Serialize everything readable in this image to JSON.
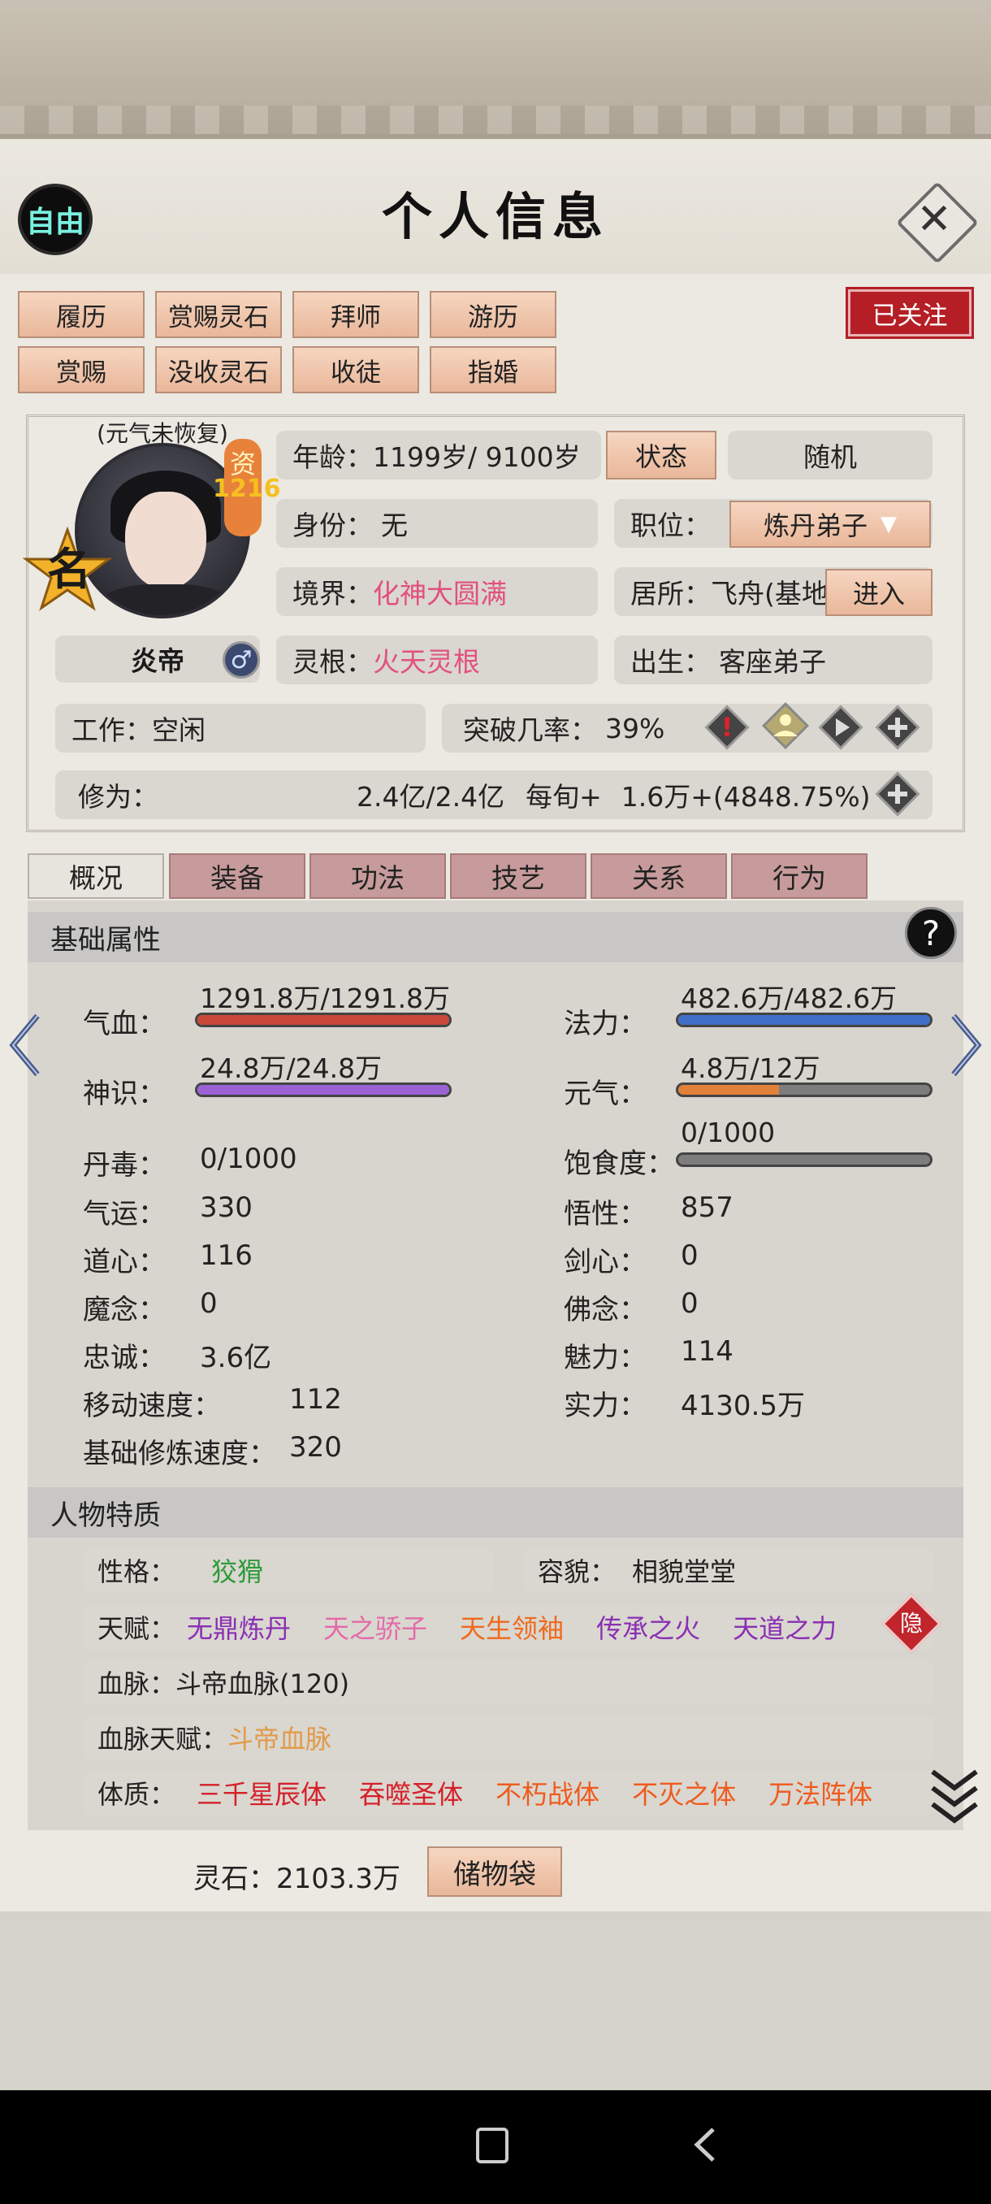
{
  "header": {
    "free_label": "自由",
    "title": "个人信息",
    "follow_label": "已关注"
  },
  "action_buttons": [
    "履历",
    "赏赐灵石",
    "拜师",
    "游历",
    "赏赐",
    "没收灵石",
    "收徒",
    "指婚"
  ],
  "profile": {
    "status_note": "(元气未恢复)",
    "zi_label": "资",
    "zi_value": "1216",
    "ming_label": "名",
    "name": "炎帝",
    "age_label": "年龄：",
    "age_value": "1199岁/ 9100岁",
    "status_btn": "状态",
    "random_btn": "随机",
    "identity_label": "身份：",
    "identity_value": "无",
    "position_label": "职位：",
    "position_value": "炼丹弟子",
    "realm_label": "境界：",
    "realm_value": "化神大圆满",
    "residence_label": "居所：",
    "residence_value": "飞舟(基地",
    "enter_btn": "进入",
    "root_label": "灵根：",
    "root_value": "火天灵根",
    "birth_label": "出生：",
    "birth_value": "客座弟子",
    "work_label": "工作：",
    "work_value": "空闲",
    "breakthrough_label": "突破几率：",
    "breakthrough_value": "39%",
    "cultivation_label": "修为：",
    "cultivation_value": "2.4亿/2.4亿",
    "per_turn_label": "每旬+",
    "per_turn_value": "1.6万+(4848.75%)"
  },
  "tabs": [
    "概况",
    "装备",
    "功法",
    "技艺",
    "关系",
    "行为"
  ],
  "basic": {
    "section_title": "基础属性",
    "hp_label": "气血：",
    "hp_value": "1291.8万/1291.8万",
    "hp_fill": 1.0,
    "mp_label": "法力：",
    "mp_value": "482.6万/482.6万",
    "mp_fill": 1.0,
    "sense_label": "神识：",
    "sense_value": "24.8万/24.8万",
    "sense_fill": 1.0,
    "vital_label": "元气：",
    "vital_value": "4.8万/12万",
    "vital_fill": 0.4,
    "satiety_label": "饱食度：",
    "satiety_value": "0/1000",
    "satiety_fill": 0.0,
    "poison_label": "丹毒：",
    "poison_value": "0/1000",
    "luck_label": "气运：",
    "luck_value": "330",
    "wisdom_label": "悟性：",
    "wisdom_value": "857",
    "dao_label": "道心：",
    "dao_value": "116",
    "sword_label": "剑心：",
    "sword_value": "0",
    "demon_label": "魔念：",
    "demon_value": "0",
    "buddha_label": "佛念：",
    "buddha_value": "0",
    "loyal_label": "忠诚：",
    "loyal_value": "3.6亿",
    "charm_label": "魅力：",
    "charm_value": "114",
    "speed_label": "移动速度：",
    "speed_value": "112",
    "power_label": "实力：",
    "power_value": "4130.5万",
    "cult_speed_label": "基础修炼速度：",
    "cult_speed_value": "320"
  },
  "traits": {
    "section_title": "人物特质",
    "personality_label": "性格：",
    "personality_value": "狡猾",
    "appearance_label": "容貌：",
    "appearance_value": "相貌堂堂",
    "talent_label": "天赋：",
    "talents": [
      {
        "name": "无鼎炼丹",
        "color": "#8b2fb3"
      },
      {
        "name": "天之骄子",
        "color": "#e46aa8"
      },
      {
        "name": "天生领袖",
        "color": "#f06a1c"
      },
      {
        "name": "传承之火",
        "color": "#8b2fb3"
      },
      {
        "name": "天道之力",
        "color": "#8b2fb3"
      }
    ],
    "hidden_label": "隐",
    "bloodline_label": "血脉：",
    "bloodline_value": "斗帝血脉(120)",
    "bloodline_talent_label": "血脉天赋：",
    "bloodline_talent_value": "斗帝血脉",
    "physique_label": "体质：",
    "physiques": [
      {
        "name": "三千星辰体",
        "color": "#d5202a"
      },
      {
        "name": "吞噬圣体",
        "color": "#d5202a"
      },
      {
        "name": "不朽战体",
        "color": "#f05a1c"
      },
      {
        "name": "不灭之体",
        "color": "#f05a1c"
      },
      {
        "name": "万法阵体",
        "color": "#f05a1c"
      }
    ]
  },
  "footer": {
    "spirit_stone_label": "灵石：",
    "spirit_stone_value": "2103.3万",
    "storage_btn": "储物袋"
  },
  "colors": {
    "hp": "#c9483a",
    "mp": "#3f6fc8",
    "sense": "#9b62d6",
    "vital": "#e2813a",
    "accent_red": "#b51e25"
  }
}
